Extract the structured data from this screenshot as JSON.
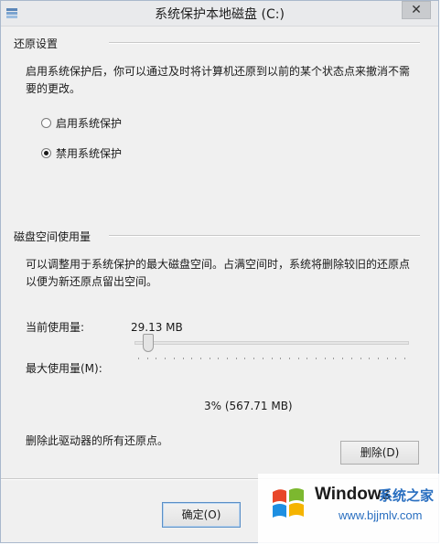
{
  "window": {
    "title": "系统保护本地磁盘 (C:)"
  },
  "restore": {
    "group_title": "还原设置",
    "description_line1": "启用系统保护后，你可以通过及时将计算机还原到以前的某个状态点来撤消不需",
    "description_line2": "要的更改。",
    "options": [
      {
        "label": "启用系统保护",
        "selected": false
      },
      {
        "label": "禁用系统保护",
        "selected": true
      }
    ]
  },
  "disk": {
    "group_title": "磁盘空间使用量",
    "description_line1": "可以调整用于系统保护的最大磁盘空间。占满空间时，系统将删除较旧的还原点",
    "description_line2": "以便为新还原点留出空间。",
    "current_label": "当前使用量:",
    "current_value": "29.13 MB",
    "max_label": "最大使用量(M):",
    "slider_level_percent": 3,
    "percent_text": "3% (567.71 MB)",
    "delete_text": "删除此驱动器的所有还原点。",
    "delete_button": "删除(D)"
  },
  "footer": {
    "ok_button": "确定(O)"
  },
  "watermark": {
    "brand": "Windows",
    "site_name": "系统之家",
    "url": "www.bjjmlv.com",
    "colors": {
      "red": "#e8472a",
      "green": "#7cb82f",
      "blue": "#1e8fe1",
      "yellow": "#f5b400"
    }
  }
}
